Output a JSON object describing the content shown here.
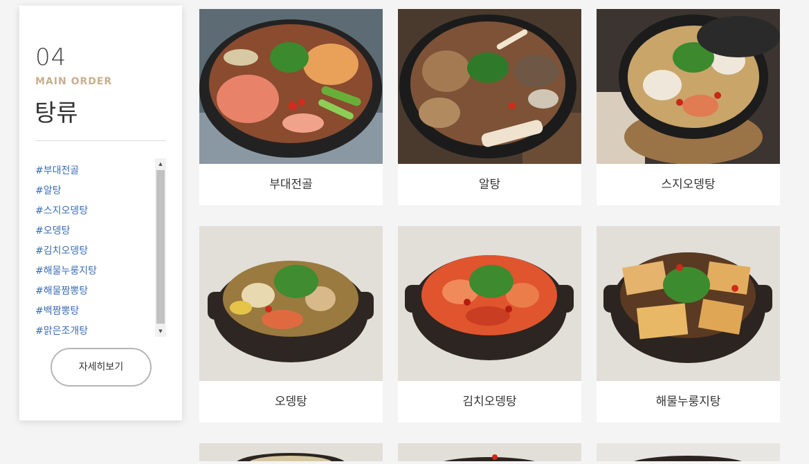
{
  "sidebar": {
    "number": "04",
    "subtitle": "MAIN ORDER",
    "title": "탕류",
    "tags": [
      "#부대전골",
      "#알탕",
      "#스지오뎅탕",
      "#오뎅탕",
      "#김치오뎅탕",
      "#해물누룽지탕",
      "#해물짬뽕탕",
      "#백짬뽕탕",
      "#맑은조개탕"
    ],
    "detail_button": "자세히보기"
  },
  "menu": {
    "items": [
      {
        "name": "부대전골",
        "image": "budae-jeongol-photo"
      },
      {
        "name": "알탕",
        "image": "altang-photo"
      },
      {
        "name": "스지오뎅탕",
        "image": "suji-odeng-tang-photo"
      },
      {
        "name": "오뎅탕",
        "image": "odeng-tang-photo"
      },
      {
        "name": "김치오뎅탕",
        "image": "kimchi-odeng-tang-photo"
      },
      {
        "name": "해물누룽지탕",
        "image": "haemul-nurungji-tang-photo"
      }
    ]
  },
  "colors": {
    "page_bg": "#f4f4f4",
    "tag_link": "#3b6db3",
    "subtitle_accent": "#c9ae8e",
    "text_dark": "#333333"
  }
}
